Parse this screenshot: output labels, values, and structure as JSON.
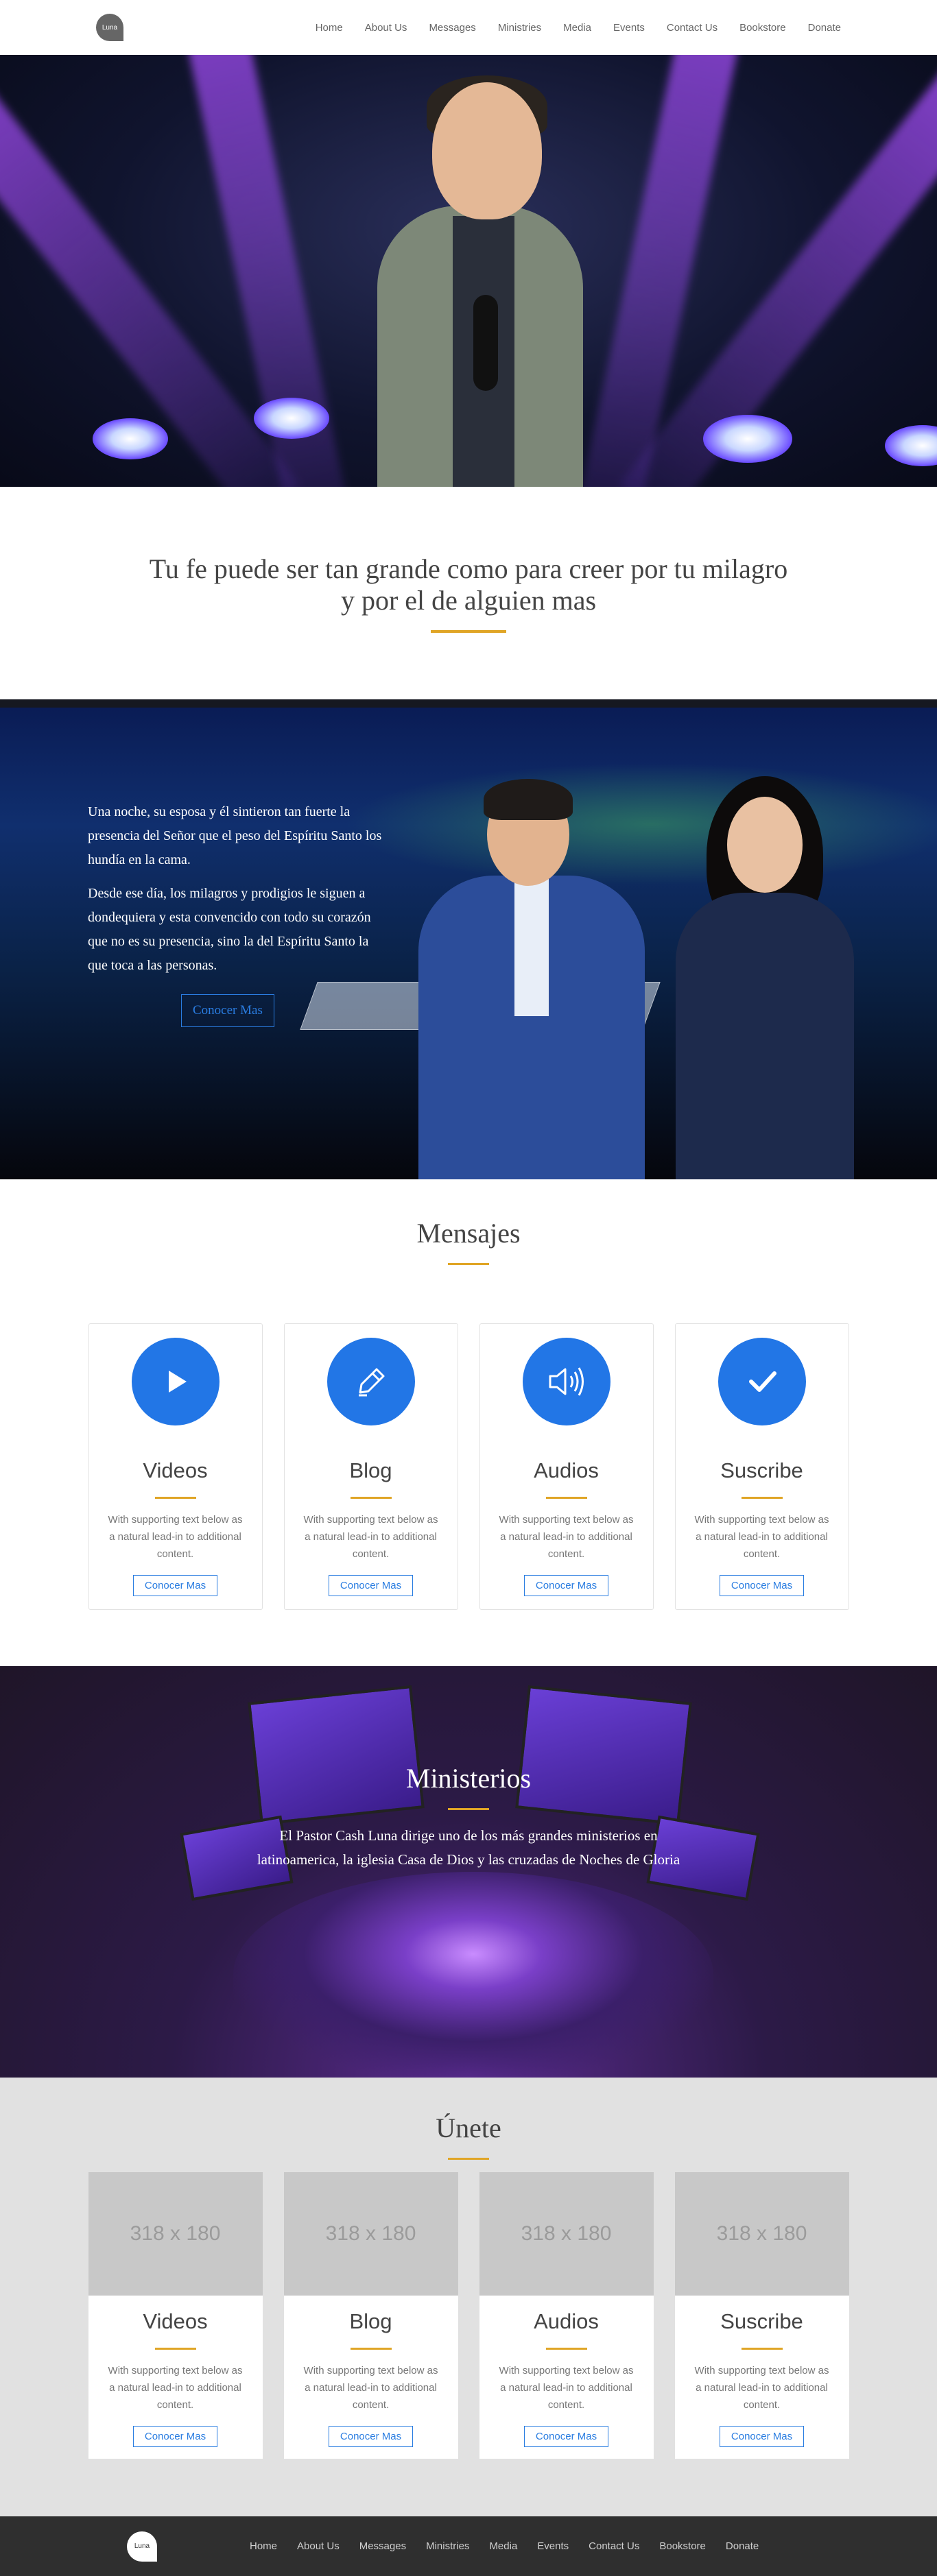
{
  "nav": {
    "logo_text": "Luna",
    "links": [
      "Home",
      "About Us",
      "Messages",
      "Ministries",
      "Media",
      "Events",
      "Contact Us",
      "Bookstore",
      "Donate"
    ]
  },
  "quote": {
    "line1": "Tu fe puede ser tan grande como para creer por tu milagro",
    "line2": "y por el de alguien mas"
  },
  "story": {
    "p1": "Una noche, su esposa y él sintieron tan fuerte la presencia del Señor que el peso del Espíritu Santo los hundía en la cama.",
    "p2": "Desde ese día, los milagros y prodigios le siguen a dondequiera y esta convencido con todo su corazón que no es su presencia, sino la del Espíritu Santo la que toca a las personas.",
    "button": "Conocer Mas"
  },
  "mensajes": {
    "title": "Mensajes",
    "cards": [
      {
        "title": "Videos",
        "text": "With supporting text below as a natural lead-in to additional content.",
        "button": "Conocer Mas",
        "icon": "play-icon"
      },
      {
        "title": "Blog",
        "text": "With supporting text below as a natural lead-in to additional content.",
        "button": "Conocer Mas",
        "icon": "pen-icon"
      },
      {
        "title": "Audios",
        "text": "With supporting text below as a natural lead-in to additional content.",
        "button": "Conocer Mas",
        "icon": "speaker-icon"
      },
      {
        "title": "Suscribe",
        "text": "With supporting text below as a natural lead-in to additional content.",
        "button": "Conocer Mas",
        "icon": "check-icon"
      }
    ]
  },
  "ministerios": {
    "title": "Ministerios",
    "text": "El Pastor Cash Luna dirige uno de los más grandes ministerios en latinoamerica, la iglesia Casa de Dios y las cruzadas de Noches de Gloria"
  },
  "unete": {
    "title": "Únete",
    "cards": [
      {
        "image": "318 x 180",
        "title": "Videos",
        "text": "With supporting text below as a natural lead-in to additional content.",
        "button": "Conocer Mas"
      },
      {
        "image": "318 x 180",
        "title": "Blog",
        "text": "With supporting text below as a natural lead-in to additional content.",
        "button": "Conocer Mas"
      },
      {
        "image": "318 x 180",
        "title": "Audios",
        "text": "With supporting text below as a natural lead-in to additional content.",
        "button": "Conocer Mas"
      },
      {
        "image": "318 x 180",
        "title": "Suscribe",
        "text": "With supporting text below as a natural lead-in to additional content.",
        "button": "Conocer Mas"
      }
    ]
  },
  "footer": {
    "logo_text": "Luna",
    "links": [
      "Home",
      "About Us",
      "Messages",
      "Ministries",
      "Media",
      "Events",
      "Contact Us",
      "Bookstore",
      "Donate"
    ]
  },
  "colors": {
    "accent_gold": "#e0a526",
    "primary_blue": "#2276e6",
    "footer_bg": "#2f2f2f"
  }
}
